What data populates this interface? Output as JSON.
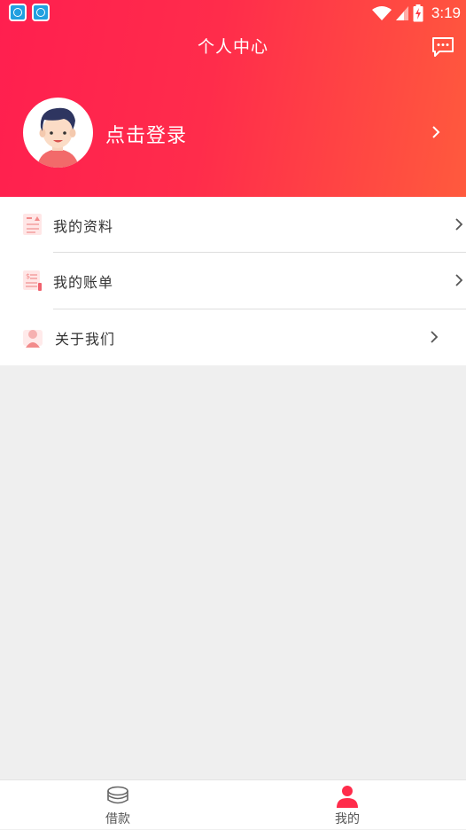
{
  "status_bar": {
    "time": "3:19"
  },
  "header": {
    "title": "个人中心"
  },
  "profile": {
    "login_label": "点击登录"
  },
  "menu": [
    {
      "label": "我的资料",
      "icon": "profile-doc-icon"
    },
    {
      "label": "我的账单",
      "icon": "bill-icon"
    },
    {
      "label": "关于我们",
      "icon": "about-person-icon"
    }
  ],
  "tabs": [
    {
      "label": "借款",
      "icon": "coins-stack-icon"
    },
    {
      "label": "我的",
      "icon": "user-icon",
      "active": true
    }
  ],
  "colors": {
    "accent": "#ff2c4b",
    "header_end": "#ff5a3d",
    "background": "#efefef"
  }
}
